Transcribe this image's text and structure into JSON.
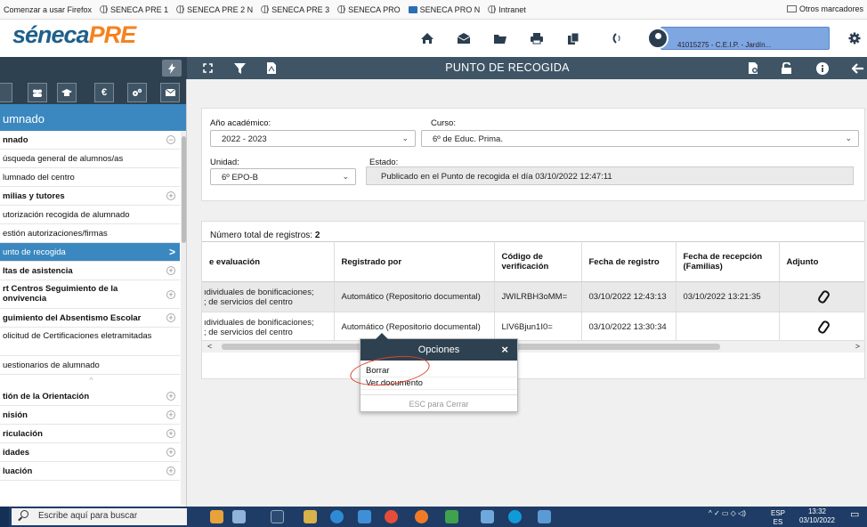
{
  "bookmarks": {
    "items": [
      "Comenzar a usar Firefox",
      "SENECA PRE 1",
      "SENECA PRE 2 N",
      "SENECA PRE 3",
      "SENECA PRO",
      "SENECA PRO N",
      "Intranet"
    ],
    "other": "Otros marcadores"
  },
  "header": {
    "logo_part1": "séneca",
    "logo_part2": "PRE",
    "user_text": "41015275 - C.E.I.P. - Jardín...",
    "icons": [
      "home-icon",
      "mail-icon",
      "folder-icon",
      "print-icon",
      "copy-icon",
      "volume-icon",
      "avatar",
      "gear-icon"
    ]
  },
  "toolbar": {
    "title": "PUNTO DE RECOGIDA",
    "left_icons": [
      "bolt-icon",
      "expand-icon",
      "filter-icon",
      "pdf-icon"
    ],
    "right_icons": [
      "export-icon",
      "unlock-icon",
      "info-icon",
      "back-arrow-icon"
    ]
  },
  "sidebar": {
    "tabs": [
      "users-icon",
      "graduation-icon",
      "euro-icon",
      "settings-icon",
      "mail-icon"
    ],
    "header": "umnado",
    "items": [
      {
        "label": "nnado",
        "bold": true,
        "toggle": "−"
      },
      {
        "label": "úsqueda general de alumnos/as"
      },
      {
        "label": "lumnado del centro"
      },
      {
        "label": "milias y tutores",
        "bold": true,
        "toggle": "+"
      },
      {
        "label": "utorización recogida de alumnado"
      },
      {
        "label": "estión autorizaciones/firmas"
      },
      {
        "label": "unto de recogida",
        "active": true,
        "chevron": ">"
      },
      {
        "label": "ltas de asistencia",
        "bold": true,
        "toggle": "+"
      },
      {
        "label": "rt Centros Seguimiento de la onvivencia",
        "bold": true,
        "toggle": "+",
        "tall": true
      },
      {
        "label": "guimiento del Absentismo Escolar",
        "bold": true,
        "toggle": "+"
      },
      {
        "label": "olicitud de Certificaciones eletramitadas",
        "tall": true
      },
      {
        "label": "uestionarios de alumnado"
      },
      {
        "label": "^",
        "collapse": true
      },
      {
        "label": "tión de la Orientación",
        "bold": true,
        "toggle": "+"
      },
      {
        "label": "nisión",
        "bold": true,
        "toggle": "+"
      },
      {
        "label": "riculación",
        "bold": true,
        "toggle": "+"
      },
      {
        "label": "idades",
        "bold": true,
        "toggle": "+"
      },
      {
        "label": "luación",
        "bold": true,
        "toggle": "+"
      }
    ]
  },
  "filters": {
    "year_label": "Año académico:",
    "year_value": "2022 - 2023",
    "course_label": "Curso:",
    "course_value": "6º de Educ. Prima.",
    "unit_label": "Unidad:",
    "unit_value": "6º EPO-B",
    "state_label": "Estado:",
    "state_value": "Publicado en el Punto de recogida el día 03/10/2022 12:47:11"
  },
  "grid": {
    "count_label": "Número total de registros:",
    "count_value": "2",
    "columns": [
      "e evaluación",
      "Registrado por",
      "Código de verificación",
      "Fecha de registro",
      "Fecha de recepción (Familias)",
      "Adjunto"
    ],
    "rows": [
      {
        "doc_line1": "ıdividuales de bonificaciones;",
        "doc_line2": "; de servicios del centro",
        "by": "Automático (Repositorio documental)",
        "code": "JWILRBH3oMM=",
        "date": "03/10/2022 12:43:13",
        "received": "03/10/2022 13:21:35",
        "attach": "paperclip-icon"
      },
      {
        "doc_line1": "ıdividuales de bonificaciones;",
        "doc_line2": "; de servicios del centro",
        "by": "Automático (Repositorio documental)",
        "code": "LIV6Bjun1I0=",
        "date": "03/10/2022 13:30:34",
        "received": "",
        "attach": "paperclip-icon"
      }
    ]
  },
  "popup": {
    "title": "Opciones",
    "close": "×",
    "items": [
      "Borrar",
      "Ver documento"
    ],
    "footer": "ESC para Cerrar"
  },
  "taskbar": {
    "search_placeholder": "Escribe aquí para buscar",
    "lang1": "ESP",
    "lang2": "ES",
    "time": "13:32",
    "date": "03/10/2022"
  },
  "colors": {
    "toolbar": "#3f5566",
    "accent": "#3b88c0",
    "logo_blue": "#1f5f8b",
    "logo_orange": "#f58220",
    "highlight_circle": "#d9432e"
  }
}
